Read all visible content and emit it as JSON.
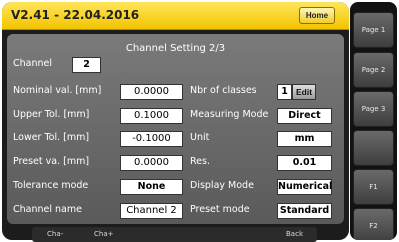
{
  "header": {
    "title": "V2.41 - 22.04.2016",
    "home_label": "Home"
  },
  "panel": {
    "title": "Channel Setting 2/3",
    "channel": {
      "label": "Channel",
      "value": "2"
    },
    "left_fields": [
      {
        "label": "Nominal val. [mm]",
        "value": "0.0000"
      },
      {
        "label": "Upper Tol. [mm]",
        "value": "0.1000"
      },
      {
        "label": "Lower Tol. [mm]",
        "value": "-0.1000"
      },
      {
        "label": "Preset va. [mm]",
        "value": "0.0000"
      },
      {
        "label": "Tolerance mode",
        "value": "None"
      },
      {
        "label": "Channel name",
        "value": "Channel 2"
      }
    ],
    "right_fields": [
      {
        "label": "Nbr of classes",
        "value": "1"
      },
      {
        "label": "Measuring Mode",
        "value": "Direct"
      },
      {
        "label": "Unit",
        "value": "mm"
      },
      {
        "label": "Res.",
        "value": "0.01"
      },
      {
        "label": "Display Mode",
        "value": "Numerical"
      },
      {
        "label": "Preset mode",
        "value": "Standard"
      }
    ],
    "edit_label": "Edit"
  },
  "bottom_bar": {
    "cha_minus": "Cha-",
    "cha_plus": "Cha+",
    "back": "Back"
  },
  "sidebar": {
    "buttons": [
      "Page 1",
      "Page 2",
      "Page 3",
      "",
      "F1",
      "F2"
    ]
  }
}
